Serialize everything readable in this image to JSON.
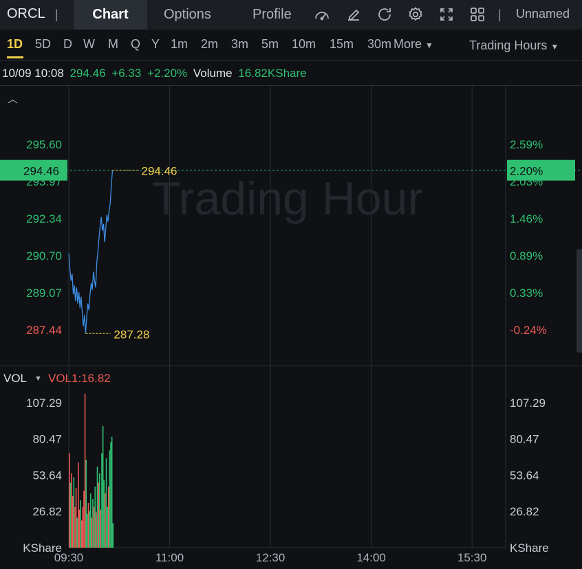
{
  "toolbar": {
    "symbol": "ORCL",
    "separator": "|",
    "tabs": [
      {
        "label": "Chart",
        "active": true
      },
      {
        "label": "Options",
        "active": false
      },
      {
        "label": "Profile",
        "active": false
      }
    ],
    "icons": [
      "gauge-icon",
      "draw-pen-icon",
      "refresh-icon",
      "settings-gear-icon",
      "fullscreen-icon",
      "layout-grid-icon"
    ],
    "user": "Unnamed"
  },
  "periods": [
    "1D",
    "5D",
    "D",
    "W",
    "M",
    "Q",
    "Y",
    "1m",
    "2m",
    "3m",
    "5m",
    "10m",
    "15m",
    "30m"
  ],
  "active_period": "1D",
  "more_label": "More",
  "session_label": "Trading Hours",
  "info": {
    "datetime": "10/09 10:08",
    "price": "294.46",
    "change": "+6.33",
    "change_pct": "+2.20%",
    "volume_label": "Volume",
    "volume_value": "16.82KShare"
  },
  "colors": {
    "background": "#0f1114",
    "up": "#2fbf71",
    "down": "#ec5a55",
    "line": "#3d8fe6",
    "highlight": "#f2d24a",
    "grid": "#2a2e35"
  },
  "chart_data": {
    "type": "line",
    "watermark": "Trading Hour",
    "price_axis_left": [
      "295.60",
      "293.97",
      "292.34",
      "290.70",
      "289.07",
      "287.44"
    ],
    "price_axis_left_values": [
      295.6,
      293.97,
      292.34,
      290.7,
      289.07,
      287.44
    ],
    "pct_axis_right": [
      "2.59%",
      "2.03%",
      "1.46%",
      "0.89%",
      "0.33%",
      "-0.24%"
    ],
    "current_price_label": "294.46",
    "current_pct_label": "2.20%",
    "high_annotation": "294.46",
    "low_annotation": "287.28",
    "high_value": 294.46,
    "low_value": 287.28,
    "time_labels": [
      "09:30",
      "11:00",
      "12:30",
      "14:00",
      "15:30"
    ],
    "session_minutes": 390,
    "series": [
      {
        "values": [
          [
            0,
            290.8
          ],
          [
            1,
            290.1
          ],
          [
            2,
            289.6
          ],
          [
            3,
            289.9
          ],
          [
            4,
            289.0
          ],
          [
            5,
            289.4
          ],
          [
            6,
            288.7
          ],
          [
            7,
            289.3
          ],
          [
            8,
            288.6
          ],
          [
            9,
            289.1
          ],
          [
            10,
            288.4
          ],
          [
            11,
            288.9
          ],
          [
            12,
            288.2
          ],
          [
            13,
            287.6
          ],
          [
            14,
            288.1
          ],
          [
            15,
            287.28
          ],
          [
            16,
            288.0
          ],
          [
            17,
            288.6
          ],
          [
            18,
            288.3
          ],
          [
            19,
            289.0
          ],
          [
            20,
            289.5
          ],
          [
            21,
            289.2
          ],
          [
            22,
            290.0
          ],
          [
            23,
            289.6
          ],
          [
            24,
            289.3
          ],
          [
            25,
            290.4
          ],
          [
            26,
            290.9
          ],
          [
            27,
            291.5
          ],
          [
            28,
            292.0
          ],
          [
            29,
            292.4
          ],
          [
            30,
            291.8
          ],
          [
            31,
            292.1
          ],
          [
            32,
            291.3
          ],
          [
            33,
            291.9
          ],
          [
            34,
            292.5
          ],
          [
            35,
            292.2
          ],
          [
            36,
            292.7
          ],
          [
            37,
            293.0
          ],
          [
            38,
            293.8
          ],
          [
            39,
            294.46
          ]
        ]
      }
    ],
    "volume": {
      "label": "VOL",
      "indicator": "VOL1:16.82",
      "axis_labels": [
        "107.29",
        "80.47",
        "53.64",
        "26.82"
      ],
      "axis_values": [
        107.29,
        80.47,
        53.64,
        26.82
      ],
      "unit": "KShare",
      "bars": [
        {
          "m": 0,
          "v": 70,
          "up": false
        },
        {
          "m": 1,
          "v": 48,
          "up": true
        },
        {
          "m": 2,
          "v": 55,
          "up": false
        },
        {
          "m": 3,
          "v": 38,
          "up": false
        },
        {
          "m": 4,
          "v": 52,
          "up": true
        },
        {
          "m": 5,
          "v": 30,
          "up": false
        },
        {
          "m": 6,
          "v": 44,
          "up": false
        },
        {
          "m": 7,
          "v": 22,
          "up": true
        },
        {
          "m": 8,
          "v": 63,
          "up": false
        },
        {
          "m": 9,
          "v": 28,
          "up": false
        },
        {
          "m": 10,
          "v": 35,
          "up": true
        },
        {
          "m": 11,
          "v": 20,
          "up": false
        },
        {
          "m": 12,
          "v": 30,
          "up": false
        },
        {
          "m": 13,
          "v": 42,
          "up": false
        },
        {
          "m": 14,
          "v": 114,
          "up": false
        },
        {
          "m": 15,
          "v": 65,
          "up": true
        },
        {
          "m": 16,
          "v": 25,
          "up": true
        },
        {
          "m": 17,
          "v": 33,
          "up": false
        },
        {
          "m": 18,
          "v": 27,
          "up": true
        },
        {
          "m": 19,
          "v": 40,
          "up": true
        },
        {
          "m": 20,
          "v": 22,
          "up": false
        },
        {
          "m": 21,
          "v": 36,
          "up": true
        },
        {
          "m": 22,
          "v": 30,
          "up": false
        },
        {
          "m": 23,
          "v": 45,
          "up": true
        },
        {
          "m": 24,
          "v": 26,
          "up": false
        },
        {
          "m": 25,
          "v": 60,
          "up": true
        },
        {
          "m": 26,
          "v": 48,
          "up": false
        },
        {
          "m": 27,
          "v": 55,
          "up": true
        },
        {
          "m": 28,
          "v": 28,
          "up": false
        },
        {
          "m": 29,
          "v": 70,
          "up": true
        },
        {
          "m": 30,
          "v": 90,
          "up": true
        },
        {
          "m": 31,
          "v": 50,
          "up": true
        },
        {
          "m": 32,
          "v": 40,
          "up": false
        },
        {
          "m": 33,
          "v": 66,
          "up": true
        },
        {
          "m": 34,
          "v": 30,
          "up": true
        },
        {
          "m": 35,
          "v": 45,
          "up": false
        },
        {
          "m": 36,
          "v": 72,
          "up": true
        },
        {
          "m": 37,
          "v": 78,
          "up": true
        },
        {
          "m": 38,
          "v": 82,
          "up": true
        },
        {
          "m": 39,
          "v": 18,
          "up": true
        }
      ]
    }
  }
}
